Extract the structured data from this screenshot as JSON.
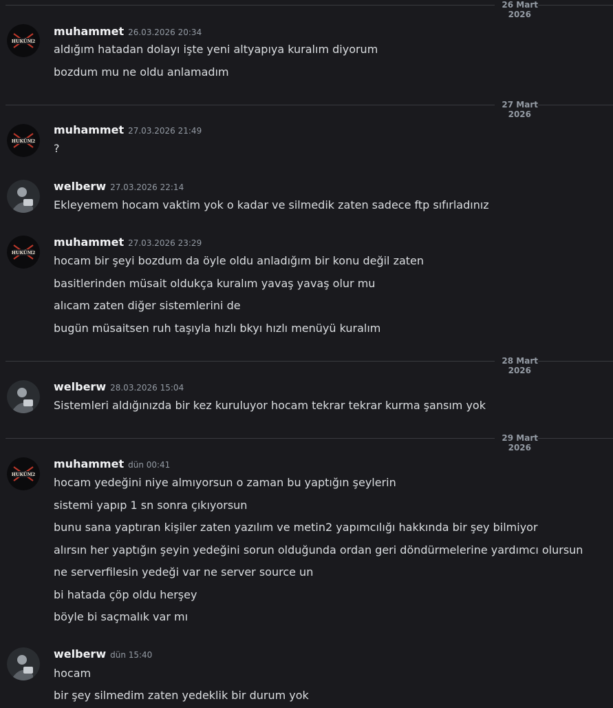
{
  "dividers": [
    {
      "date": "26 Mart 2026"
    },
    {
      "date": "27 Mart 2026"
    },
    {
      "date": "28 Mart 2026"
    },
    {
      "date": "29 Mart 2026"
    }
  ],
  "avatars": {
    "muhammet": {
      "label": "HUKÜM 2",
      "bg": "#0b0b0d",
      "accent": "#c0392b"
    },
    "welberw": {
      "bg": "#2a2d31",
      "accent": "#9aa0a6"
    }
  },
  "groups": [
    {
      "author": "muhammet",
      "timestamp": "26.03.2026 20:34",
      "lines": [
        "aldığım hatadan dolayı işte yeni altyapıya kuralım diyorum",
        "bozdum mu ne oldu anlamadım"
      ]
    },
    {
      "author": "muhammet",
      "timestamp": "27.03.2026 21:49",
      "lines": [
        "?"
      ]
    },
    {
      "author": "welberw",
      "timestamp": "27.03.2026 22:14",
      "lines": [
        "Ekleyemem hocam vaktim yok o kadar ve silmedik zaten sadece ftp sıfırladınız"
      ]
    },
    {
      "author": "muhammet",
      "timestamp": "27.03.2026 23:29",
      "lines": [
        "hocam bir şeyi bozdum da öyle oldu anladığım bir konu değil zaten",
        "basitlerinden müsait oldukça kuralım yavaş yavaş olur mu",
        "alıcam zaten diğer sistemlerini de",
        "bugün müsaitsen ruh taşıyla hızlı bkyı hızlı menüyü kuralım"
      ]
    },
    {
      "author": "welberw",
      "timestamp": "28.03.2026 15:04",
      "lines": [
        "Sistemleri aldığınızda bir kez kuruluyor hocam tekrar tekrar kurma şansım yok"
      ]
    },
    {
      "author": "muhammet",
      "timestamp": "dün 00:41",
      "lines": [
        "hocam yedeğini niye almıyorsun o zaman bu yaptığın şeylerin",
        "sistemi yapıp 1 sn sonra çıkıyorsun",
        "bunu sana yaptıran kişiler zaten yazılım ve metin2 yapımcılığı hakkında bir şey bilmiyor",
        "alırsın her yaptığın şeyin yedeğini sorun olduğunda ordan geri döndürmelerine yardımcı olursun",
        "ne serverfilesin yedeği var ne server source un",
        "bi hatada çöp oldu herşey",
        "böyle bi saçmalık var mı"
      ]
    },
    {
      "author": "welberw",
      "timestamp": "dün 15:40",
      "lines": [
        "hocam",
        "bir şey silmedim zaten yedeklik bir durum yok"
      ]
    }
  ]
}
